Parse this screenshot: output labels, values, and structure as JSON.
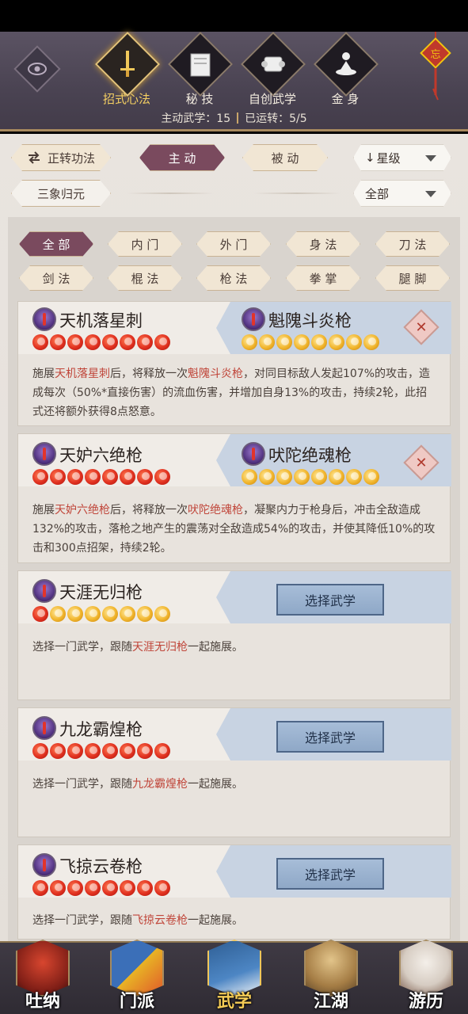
{
  "header": {
    "tabs": [
      {
        "label": "招式心法",
        "icon": "sword-icon",
        "active": true
      },
      {
        "label": "秘 技",
        "icon": "book-icon",
        "active": false
      },
      {
        "label": "自创武学",
        "icon": "scroll-icon",
        "active": false
      },
      {
        "label": "金 身",
        "icon": "meditation-icon",
        "active": false
      }
    ],
    "stats_active": "主动武学：15",
    "stats_running": "已运转：5/5"
  },
  "controls": {
    "reverse_btn": "正转功法",
    "active_btn": "主 动",
    "passive_btn": "被 动",
    "sort_select": "星级",
    "sanxiang_btn": "三象归元",
    "filter_select": "全部"
  },
  "categories": [
    "全 部",
    "内 门",
    "外 门",
    "身 法",
    "刀 法",
    "剑 法",
    "棍 法",
    "枪 法",
    "拳 掌",
    "腿 脚"
  ],
  "cards": [
    {
      "name": "天机落星刺",
      "stars": 8,
      "partner": "魁隗斗炎枪",
      "partner_stars": 8,
      "desc_pre": "施展",
      "desc_skill": "天机落星刺",
      "desc_mid": "后，将释放一次",
      "desc_partner": "魁隗斗炎枪",
      "desc_post": "，对同目标敌人发起107%的攻击，造成每次（50%*直接伤害）的流血伤害，并增加自身13%的攻击，持续2轮，此招式还将额外获得8点怒意。"
    },
    {
      "name": "天妒六绝枪",
      "stars": 8,
      "partner": "吠陀绝魂枪",
      "partner_stars": 8,
      "desc_pre": "施展",
      "desc_skill": "天妒六绝枪",
      "desc_mid": "后，将释放一次",
      "desc_partner": "吠陀绝魂枪",
      "desc_post": "，凝聚内力于枪身后，冲击全敌造成132%的攻击，落枪之地产生的震荡对全敌造成54%的攻击，并使其降低10%的攻击和300点招架，持续2轮。"
    },
    {
      "name": "天涯无归枪",
      "stars_red": 1,
      "stars_gold": 7,
      "button": "选择武学",
      "hint_pre": "选择一门武学，跟随",
      "hint_skill": "天涯无归枪",
      "hint_post": "一起施展。"
    },
    {
      "name": "九龙霸煌枪",
      "stars": 8,
      "button": "选择武学",
      "hint_pre": "选择一门武学，跟随",
      "hint_skill": "九龙霸煌枪",
      "hint_post": "一起施展。"
    },
    {
      "name": "飞掠云卷枪",
      "stars": 8,
      "button": "选择武学",
      "hint_pre": "选择一门武学，跟随",
      "hint_skill": "飞掠云卷枪",
      "hint_post": "一起施展。"
    }
  ],
  "bottom_nav": [
    {
      "label": "吐纳",
      "icon": "meditate-figure-icon"
    },
    {
      "label": "门派",
      "icon": "sect-banner-icon"
    },
    {
      "label": "武学",
      "icon": "martial-book-icon",
      "active": true
    },
    {
      "label": "江湖",
      "icon": "straw-hat-icon"
    },
    {
      "label": "游历",
      "icon": "horse-icon"
    }
  ],
  "colors": {
    "accent": "#7a4a5e",
    "highlight": "#c0463a",
    "gold": "#f4cf62"
  }
}
